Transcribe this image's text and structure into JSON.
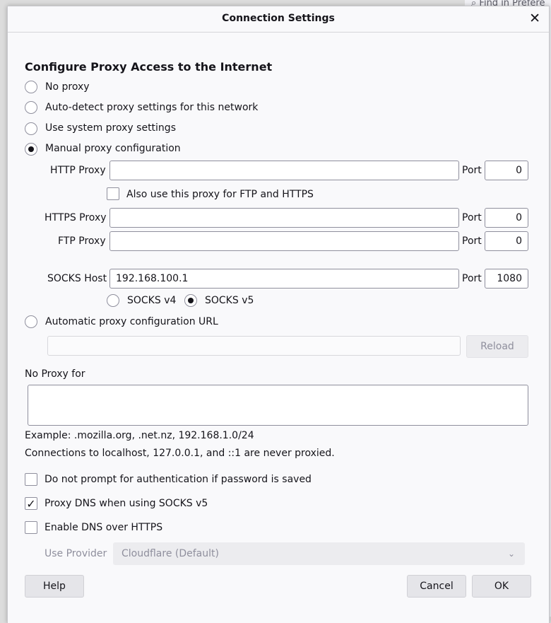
{
  "background": {
    "find_placeholder": "Find in Prefere"
  },
  "dialog": {
    "title": "Connection Settings",
    "close_glyph": "✕"
  },
  "section": {
    "heading": "Configure Proxy Access to the Internet"
  },
  "options": {
    "no_proxy": {
      "label": "No proxy",
      "selected": false
    },
    "auto_detect": {
      "label": "Auto-detect proxy settings for this network",
      "selected": false
    },
    "system": {
      "label": "Use system proxy settings",
      "selected": false
    },
    "manual": {
      "label": "Manual proxy configuration",
      "selected": true
    },
    "auto_url": {
      "label": "Automatic proxy configuration URL",
      "selected": false
    }
  },
  "manual": {
    "http_label": "HTTP Proxy",
    "http_value": "",
    "http_port": "0",
    "also_use_label": "Also use this proxy for FTP and HTTPS",
    "also_use_checked": false,
    "https_label": "HTTPS Proxy",
    "https_value": "",
    "https_port": "0",
    "ftp_label": "FTP Proxy",
    "ftp_value": "",
    "ftp_port": "0",
    "socks_label": "SOCKS Host",
    "socks_value": "192.168.100.1",
    "socks_port": "1080",
    "port_label": "Port",
    "socks_v4_label": "SOCKS v4",
    "socks_v5_label": "SOCKS v5",
    "socks_version": "v5"
  },
  "auto_url": {
    "value": "",
    "reload_label": "Reload"
  },
  "no_proxy": {
    "label": "No Proxy for",
    "value": "",
    "example": "Example: .mozilla.org, .net.nz, 192.168.1.0/24",
    "note": "Connections to localhost, 127.0.0.1, and ::1 are never proxied."
  },
  "checkboxes": {
    "no_prompt": {
      "label": "Do not prompt for authentication if password is saved",
      "checked": false
    },
    "proxy_dns": {
      "label": "Proxy DNS when using SOCKS v5",
      "checked": true
    },
    "dns_https": {
      "label": "Enable DNS over HTTPS",
      "checked": false
    }
  },
  "provider": {
    "label": "Use Provider",
    "value": "Cloudflare (Default)"
  },
  "buttons": {
    "help": "Help",
    "cancel": "Cancel",
    "ok": "OK"
  },
  "check_glyph": "✓",
  "chevron_glyph": "⌄"
}
